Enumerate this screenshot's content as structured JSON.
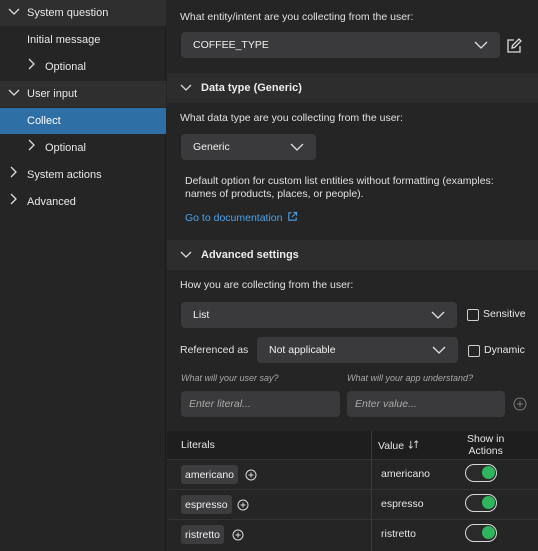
{
  "sidebar": {
    "items": [
      {
        "label": "System question",
        "expanded": true
      },
      {
        "label": "Initial message"
      },
      {
        "label": "Optional",
        "collapsed": true
      },
      {
        "label": "User input",
        "expanded": true
      },
      {
        "label": "Collect",
        "selected": true
      },
      {
        "label": "Optional",
        "collapsed": true
      },
      {
        "label": "System actions",
        "collapsed": true
      },
      {
        "label": "Advanced",
        "collapsed": true
      }
    ]
  },
  "entity": {
    "question": "What entity/intent are you collecting from the user:",
    "value": "COFFEE_TYPE"
  },
  "data_type_section": {
    "title": "Data type (Generic)",
    "question": "What data type are you collecting from the user:",
    "value": "Generic",
    "description": "Default option for custom list entities without formatting (examples: names of products, places, or people).",
    "description_line1": "Default option for custom list entities without formatting (examples:",
    "description_line2": "names of products, places, or people).",
    "doc_link": "Go to documentation"
  },
  "advanced_section": {
    "title": "Advanced settings",
    "question": "How you are collecting from the user:",
    "method_value": "List",
    "sensitive_label": "Sensitive",
    "referenced_label": "Referenced as",
    "referenced_value": "Not applicable",
    "dynamic_label": "Dynamic",
    "literal_hint": "What will your user say?",
    "value_hint": "What will your app understand?",
    "literal_placeholder": "Enter literal...",
    "value_placeholder": "Enter value..."
  },
  "table": {
    "headers": {
      "literals": "Literals",
      "value": "Value",
      "show_line1": "Show in",
      "show_line2": "Actions"
    },
    "rows": [
      {
        "literal": "americano",
        "value": "americano",
        "show": true
      },
      {
        "literal": "espresso",
        "value": "espresso",
        "show": true
      },
      {
        "literal": "ristretto",
        "value": "ristretto",
        "show": true
      }
    ]
  },
  "colors": {
    "accent": "#2e6fa6",
    "link": "#4aa3e8",
    "toggle_on": "#2fb55d"
  }
}
